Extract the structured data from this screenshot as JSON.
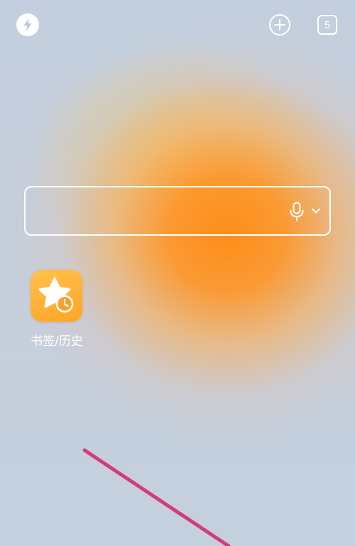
{
  "app": {
    "accent_color": "#ffa424",
    "background_glow_color": "#ff8c14"
  },
  "top_bar": {
    "quick_action_icon": "lightning-bolt-icon",
    "add_icon": "plus-circle-icon",
    "tab_count": "5"
  },
  "search": {
    "value": "",
    "placeholder": "",
    "voice_icon": "microphone-icon",
    "dropdown_icon": "chevron-down-icon"
  },
  "shortcuts": [
    {
      "label": "书签/历史",
      "icon": "star-clock-icon",
      "color": "#ffa424"
    }
  ],
  "overlay": {
    "swipe_trace_color": "#d63a7a"
  }
}
